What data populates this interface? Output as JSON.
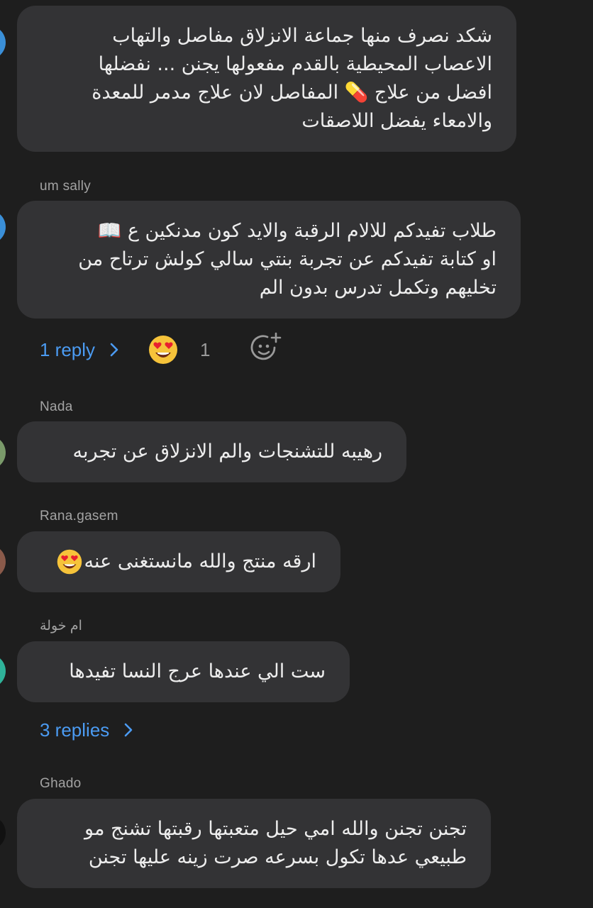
{
  "comments": [
    {
      "author": "",
      "text": "شكد نصرف منها جماعة الانزلاق مفاصل  والتهاب\nالاعصاب المحيطية بالقدم مفعولها يجنن  ... نفضلها\nافضل من علاج 💊 المفاصل لان علاج مدمر للمعدة\nوالامعاء  يفضل اللاصقات",
      "avatar_color": "#3a8fd8"
    },
    {
      "author": "um sally",
      "text": "طلاب تفيدكم للالام الرقبة والايد كون مدنكين ع 📖\nاو كتابة تفيدكم عن تجربة بنتي سالي  كولش ترتاح من\nتخليهم  وتكمل تدرس بدون الم",
      "avatar_color": "#3a8fd8",
      "reply_label": "1 reply",
      "reaction_emoji": "heart-eyes",
      "reaction_count": "1"
    },
    {
      "author": "Nada",
      "text": "رهيبه للتشنجات والم الانزلاق عن تجربه",
      "avatar_color": "#7a9a6a"
    },
    {
      "author": "Rana.gasem",
      "text": "ارقه منتج والله مانستغنى عنه",
      "avatar_color": "#8a5a4a"
    },
    {
      "author": "ام خولة",
      "text": "ست الي عندها عرج النسا تفيدها",
      "avatar_color": "#2fb39a",
      "reply_label": "3 replies"
    },
    {
      "author": "Ghado",
      "text": "تجنن تجنن والله امي حيل متعبتها رقبتها تشنج مو\nطبيعي عدها تكول بسرعه صرت زينه عليها تجنن",
      "avatar_color": "#111111"
    }
  ],
  "colors": {
    "background": "#1e1e1e",
    "bubble": "#333335",
    "link": "#4b9bf2",
    "muted": "#a3a3a3"
  }
}
